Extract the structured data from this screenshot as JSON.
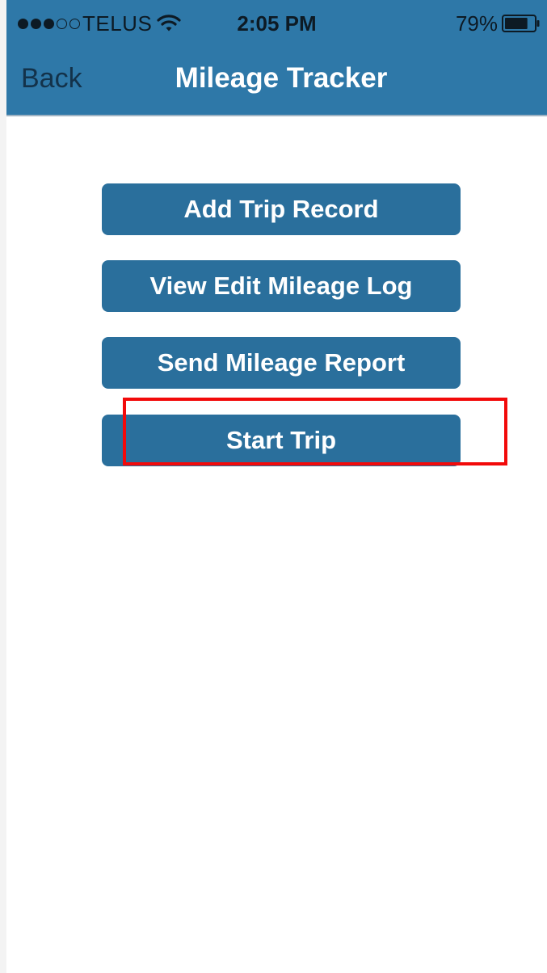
{
  "status_bar": {
    "signal": [
      true,
      true,
      true,
      false,
      false
    ],
    "carrier": "TELUS",
    "wifi_icon": "wifi-icon",
    "time": "2:05 PM",
    "battery_percent": "79%",
    "battery_icon": "battery-icon",
    "battery_level": 0.79
  },
  "nav_bar": {
    "back_label": "Back",
    "title": "Mileage Tracker"
  },
  "menu": {
    "add_trip_label": "Add Trip Record",
    "view_edit_label": "View Edit Mileage Log",
    "send_report_label": "Send Mileage Report",
    "start_trip_label": "Start Trip"
  },
  "colors": {
    "header_background": "#2e78a8",
    "button_background": "#2a6f9c",
    "highlight": "#f20a0a"
  }
}
